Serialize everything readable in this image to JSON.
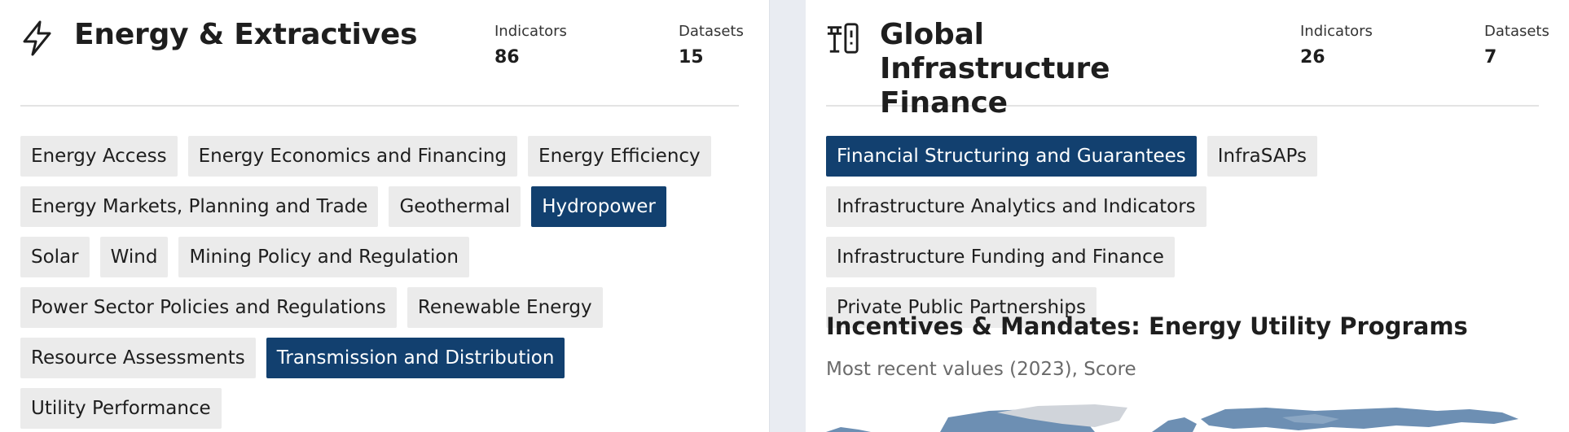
{
  "left_panel": {
    "title": "Energy & Extractives",
    "icon": "lightning-bolt-icon",
    "stats": [
      {
        "label": "Indicators",
        "value": "86"
      },
      {
        "label": "Datasets",
        "value": "15"
      }
    ],
    "tags": [
      {
        "label": "Energy Access",
        "selected": false
      },
      {
        "label": "Energy Economics and Financing",
        "selected": false
      },
      {
        "label": "Energy Efficiency",
        "selected": false
      },
      {
        "label": "Energy Markets, Planning and Trade",
        "selected": false
      },
      {
        "label": "Geothermal",
        "selected": false
      },
      {
        "label": "Hydropower",
        "selected": true
      },
      {
        "label": "Solar",
        "selected": false
      },
      {
        "label": "Wind",
        "selected": false
      },
      {
        "label": "Mining Policy and Regulation",
        "selected": false
      },
      {
        "label": "Power Sector Policies and Regulations",
        "selected": false
      },
      {
        "label": "Renewable Energy",
        "selected": false
      },
      {
        "label": "Resource Assessments",
        "selected": false
      },
      {
        "label": "Transmission and Distribution",
        "selected": true
      },
      {
        "label": "Utility Performance",
        "selected": false
      }
    ]
  },
  "right_panel": {
    "title": "Global Infrastructure Finance",
    "icon": "infrastructure-pylon-icon",
    "stats": [
      {
        "label": "Indicators",
        "value": "26"
      },
      {
        "label": "Datasets",
        "value": "7"
      }
    ],
    "tags": [
      {
        "label": "Financial Structuring and Guarantees",
        "selected": true
      },
      {
        "label": "InfraSAPs",
        "selected": false
      },
      {
        "label": "Infrastructure Analytics and Indicators",
        "selected": false
      },
      {
        "label": "Infrastructure Funding and Finance",
        "selected": false
      },
      {
        "label": "Private Public Partnerships",
        "selected": false
      }
    ],
    "indicator": {
      "title": "Incentives & Mandates: Energy Utility Programs",
      "subtitle": "Most recent values (2023), Score"
    }
  },
  "colors": {
    "selected_tag_bg": "#12406f",
    "tag_bg": "#ebebeb",
    "gutter_bg": "#e9ecf2",
    "map_fill": "#6d8fb3",
    "map_nodata": "#d0d4da"
  }
}
